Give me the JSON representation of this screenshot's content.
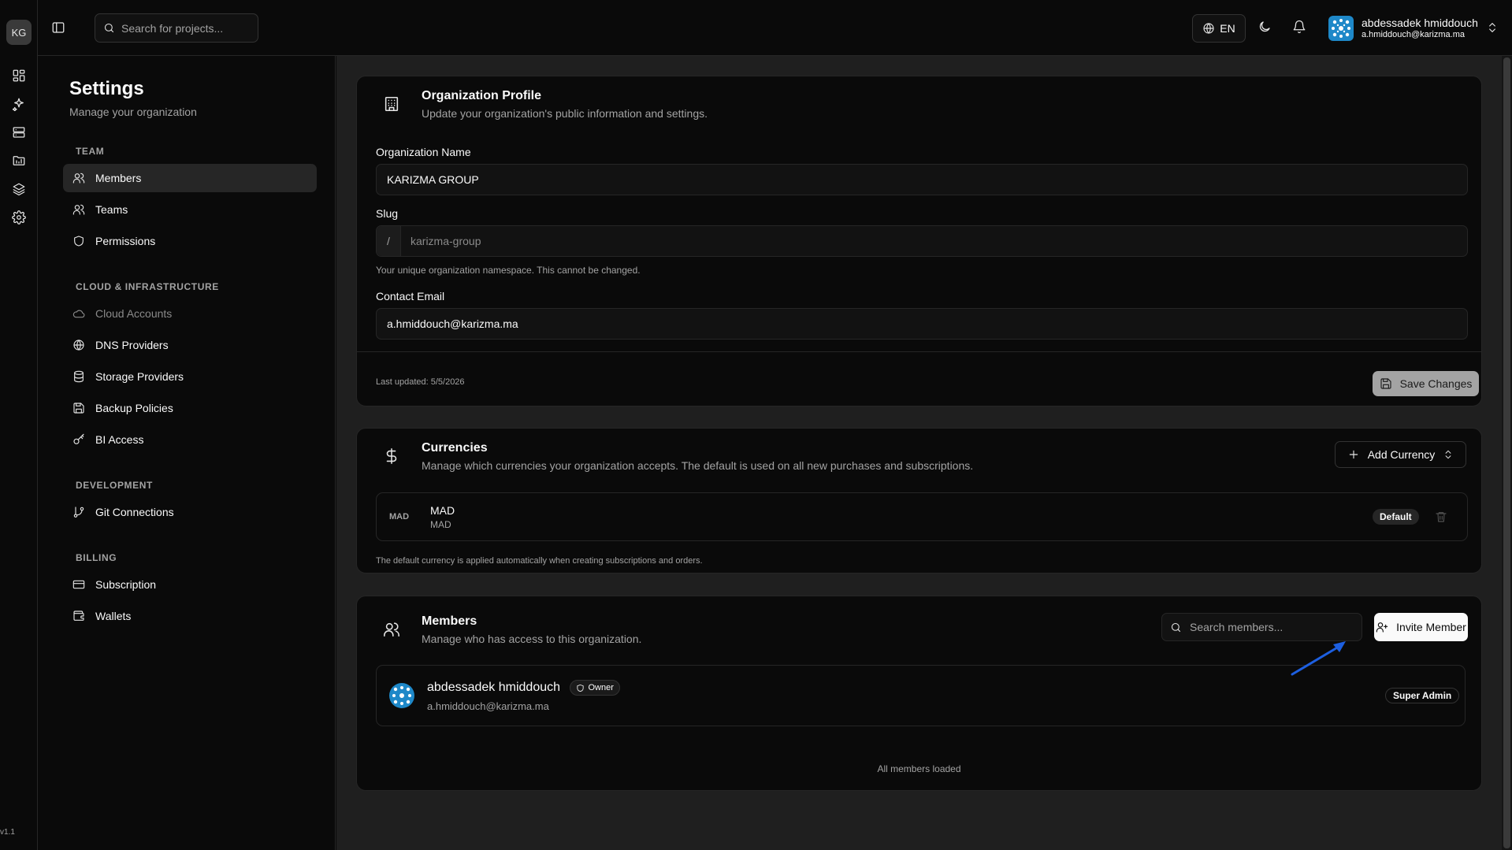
{
  "rail": {
    "logo": "KG",
    "version": "v1.1",
    "icons": [
      "dashboard-icon",
      "sparkles-icon",
      "servers-icon",
      "projects-icon",
      "layers-icon",
      "settings-icon"
    ]
  },
  "topbar": {
    "search_placeholder": "Search for projects...",
    "language": "EN",
    "user": {
      "name": "abdessadek hmiddouch",
      "email": "a.hmiddouch@karizma.ma"
    }
  },
  "sidebar": {
    "title": "Settings",
    "subtitle": "Manage your organization",
    "groups": [
      {
        "label": "TEAM",
        "items": [
          {
            "label": "Members",
            "icon": "users-icon",
            "active": true
          },
          {
            "label": "Teams",
            "icon": "team-icon"
          },
          {
            "label": "Permissions",
            "icon": "shield-icon"
          }
        ]
      },
      {
        "label": "CLOUD & INFRASTRUCTURE",
        "items": [
          {
            "label": "Cloud Accounts",
            "icon": "cloud-icon",
            "disabled": true
          },
          {
            "label": "DNS Providers",
            "icon": "globe-icon"
          },
          {
            "label": "Storage Providers",
            "icon": "database-icon"
          },
          {
            "label": "Backup Policies",
            "icon": "save-icon"
          },
          {
            "label": "BI Access",
            "icon": "key-icon"
          }
        ]
      },
      {
        "label": "DEVELOPMENT",
        "items": [
          {
            "label": "Git Connections",
            "icon": "git-branch-icon"
          }
        ]
      },
      {
        "label": "BILLING",
        "items": [
          {
            "label": "Subscription",
            "icon": "credit-card-icon"
          },
          {
            "label": "Wallets",
            "icon": "wallet-icon"
          }
        ]
      }
    ]
  },
  "org_profile": {
    "title": "Organization Profile",
    "description": "Update your organization's public information and settings.",
    "name_label": "Organization Name",
    "name_value": "KARIZMA GROUP",
    "slug_label": "Slug",
    "slug_prefix": "/",
    "slug_value": "karizma-group",
    "slug_hint": "Your unique organization namespace. This cannot be changed.",
    "email_label": "Contact Email",
    "email_value": "a.hmiddouch@karizma.ma",
    "last_updated": "Last updated: 5/5/2026",
    "save_label": "Save Changes"
  },
  "currencies": {
    "title": "Currencies",
    "description": "Manage which currencies your organization accepts. The default is used on all new purchases and subscriptions.",
    "add_label": "Add Currency",
    "items": [
      {
        "code_tag": "MAD",
        "name": "MAD",
        "code": "MAD",
        "badge": "Default"
      }
    ],
    "hint": "The default currency is applied automatically when creating subscriptions and orders."
  },
  "members": {
    "title": "Members",
    "description": "Manage who has access to this organization.",
    "search_placeholder": "Search members...",
    "invite_label": "Invite Member",
    "list": [
      {
        "name": "abdessadek hmiddouch",
        "tag": "Owner",
        "email": "a.hmiddouch@karizma.ma",
        "role": "Super Admin"
      }
    ],
    "footer": "All members loaded"
  },
  "colors": {
    "background": "#0a0a0a",
    "panel": "#1f1f1f",
    "border": "#262626",
    "annotation_arrow": "#1d5fe0"
  }
}
